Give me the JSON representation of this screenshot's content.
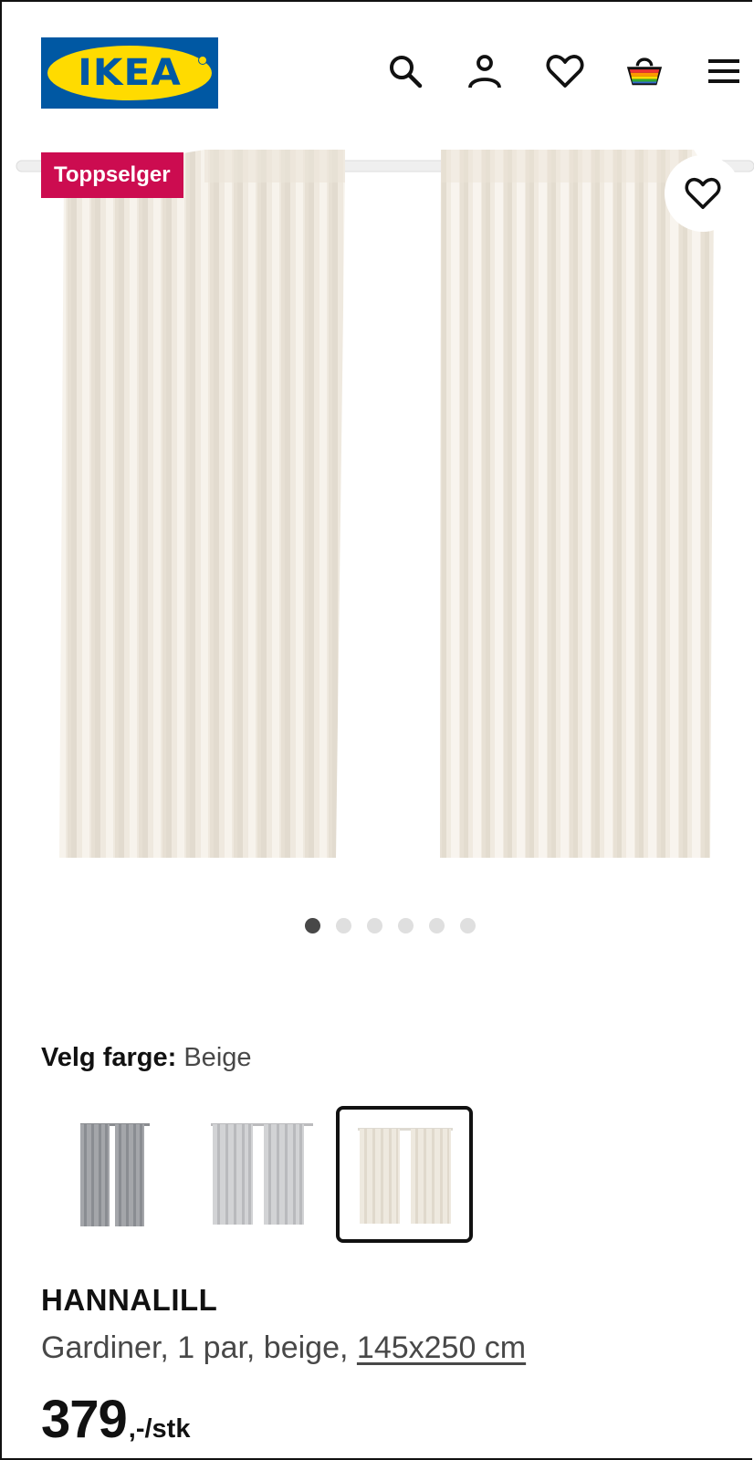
{
  "header": {
    "logo_text": "IKEA",
    "icons": [
      "search-icon",
      "user-icon",
      "heart-icon",
      "basket-icon",
      "menu-icon"
    ]
  },
  "gallery": {
    "badge": "Toppselger",
    "dot_count": 6,
    "active_dot": 1
  },
  "color_selector": {
    "label": "Velg farge:",
    "value": "Beige",
    "options": [
      {
        "name": "dark-grey",
        "color": "#9a9ca0",
        "selected": false
      },
      {
        "name": "light-grey",
        "color": "#c9cacc",
        "selected": false
      },
      {
        "name": "beige",
        "color": "#ece6dc",
        "selected": true
      }
    ]
  },
  "product": {
    "name": "HANNALILL",
    "description_prefix": "Gardiner, 1 par, beige,",
    "size_link": "145x250 cm",
    "price_amount": "379",
    "price_suffix": ",-/stk"
  },
  "colors": {
    "ikea_blue": "#0058a3",
    "ikea_yellow": "#ffdb00",
    "badge_red": "#cc0c50"
  }
}
